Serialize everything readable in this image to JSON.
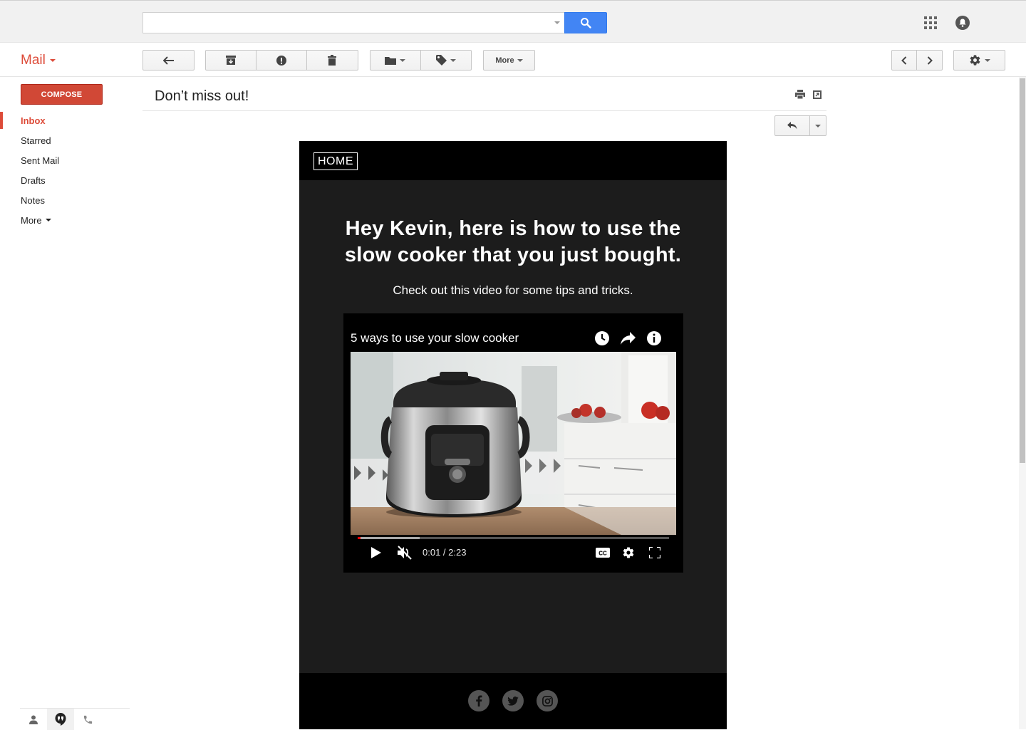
{
  "header": {
    "search": {
      "value": "",
      "placeholder": ""
    },
    "icons": [
      "search-icon",
      "apps-grid-icon",
      "notifications-bell-icon"
    ]
  },
  "toolbar": {
    "mail_label": "Mail",
    "more_label": "More",
    "buttons": [
      "back-arrow-icon",
      "archive-icon",
      "report-spam-icon",
      "delete-icon",
      "move-to-folder-icon",
      "labels-icon",
      "older-chevron-icon",
      "newer-chevron-icon",
      "settings-gear-icon"
    ]
  },
  "sidebar": {
    "compose_label": "COMPOSE",
    "items": [
      {
        "label": "Inbox",
        "active": true
      },
      {
        "label": "Starred"
      },
      {
        "label": "Sent Mail"
      },
      {
        "label": "Drafts"
      },
      {
        "label": "Notes"
      },
      {
        "label": "More"
      }
    ],
    "bottom_tabs": [
      "contacts-icon",
      "hangouts-icon",
      "phone-icon"
    ]
  },
  "message": {
    "subject": "Don’t miss out!"
  },
  "email_body": {
    "home_label": "HOME",
    "headline": "Hey Kevin, here is how to use the slow cooker that you just bought.",
    "subline": "Check out this video for some tips and tricks.",
    "video": {
      "title": "5 ways to use your slow cooker",
      "time": "0:01 / 2:23",
      "played_fraction": 0.007,
      "buffered_fraction": 0.2,
      "icons": [
        "watch-later-clock-icon",
        "share-arrow-icon",
        "info-icon",
        "play-icon",
        "muted-speaker-icon",
        "captions-cc-icon",
        "video-settings-gear-icon",
        "fullscreen-icon"
      ]
    },
    "social": [
      "facebook-icon",
      "twitter-icon",
      "instagram-icon"
    ]
  },
  "colors": {
    "brand_red": "#dd4b39",
    "compose_red": "#d14836",
    "search_blue": "#4285f4",
    "email_bg": "#1c1c1c",
    "email_header": "#000000"
  }
}
